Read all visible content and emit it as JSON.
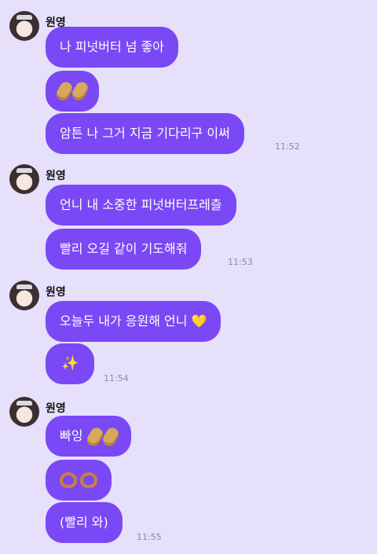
{
  "groups": [
    {
      "sender": "원영",
      "messages": [
        {
          "text": "나 피넛버터 넘 좋아"
        },
        {
          "emoji": "peanut-peanut"
        },
        {
          "text": "암튼 나 그거 지금 기다리구 이써"
        }
      ],
      "time": "11:52"
    },
    {
      "sender": "원영",
      "messages": [
        {
          "text": "언니 내 소중한 피넛버터프레츨"
        },
        {
          "text": "빨리 오길 같이 기도해줘"
        }
      ],
      "time": "11:53"
    },
    {
      "sender": "원영",
      "messages": [
        {
          "text": "오늘두 내가 응원해 언니",
          "emoji_suffix": "💛"
        },
        {
          "emoji": "✨"
        }
      ],
      "time": "11:54"
    },
    {
      "sender": "원영",
      "messages": [
        {
          "text": "빠잉",
          "emoji_suffix": "peanut-peanut"
        },
        {
          "emoji": "pretzel-pretzel"
        },
        {
          "text": "(빨리 와)"
        }
      ],
      "time": "11:55"
    }
  ],
  "colors": {
    "background": "#e6e0fb",
    "bubble": "#7a48f5",
    "bubble_text": "#ffffff",
    "time_text": "#8c8a99"
  }
}
